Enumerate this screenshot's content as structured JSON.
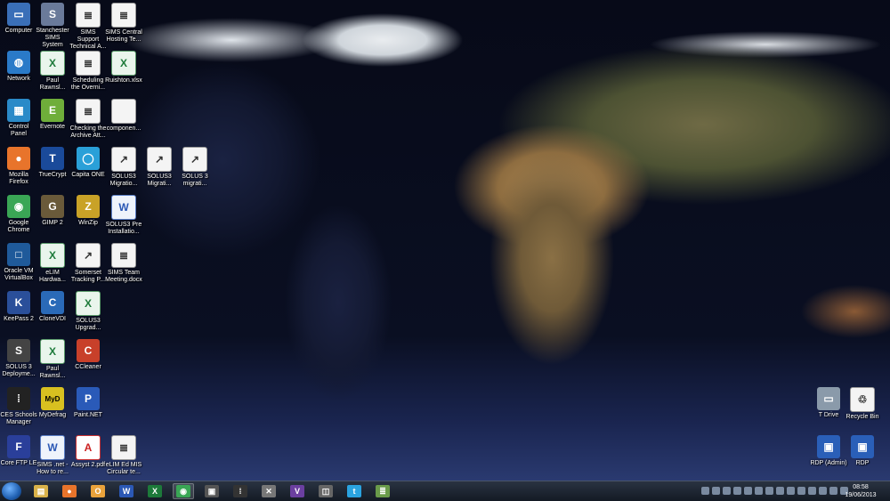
{
  "desktop_icons": [
    {
      "label": "Computer",
      "icon": "computer-icon"
    },
    {
      "label": "Stanchester SIMS System",
      "icon": "sims-icon"
    },
    {
      "label": "SIMS Support Technical A...",
      "icon": "document-icon"
    },
    {
      "label": "SIMS Central Hosting Te...",
      "icon": "document-icon"
    },
    {
      "label": "Network",
      "icon": "network-icon"
    },
    {
      "label": "Paul Rawnsl...",
      "icon": "excel-icon"
    },
    {
      "label": "Scheduling the Overni...",
      "icon": "document-icon"
    },
    {
      "label": "Ruishton.xlsx",
      "icon": "excel-icon"
    },
    {
      "label": "Control Panel",
      "icon": "control-panel-icon"
    },
    {
      "label": "Evernote",
      "icon": "evernote-icon"
    },
    {
      "label": "Checking the Archive Att...",
      "icon": "document-icon"
    },
    {
      "label": "componen...",
      "icon": "file-icon"
    },
    {
      "label": "Mozilla Firefox",
      "icon": "firefox-icon"
    },
    {
      "label": "TrueCrypt",
      "icon": "truecrypt-icon"
    },
    {
      "label": "Capita ONE",
      "icon": "capita-icon"
    },
    {
      "label": "SOLUS3 Migratio...",
      "icon": "shortcut-icon"
    },
    {
      "label": "SOLUS3 Migrati...",
      "icon": "shortcut-icon"
    },
    {
      "label": "SOLUS 3 migrati...",
      "icon": "shortcut-icon"
    },
    {
      "label": "Google Chrome",
      "icon": "chrome-icon"
    },
    {
      "label": "GIMP 2",
      "icon": "gimp-icon"
    },
    {
      "label": "WinZip",
      "icon": "winzip-icon"
    },
    {
      "label": "SOLUS3 Pre Installatio...",
      "icon": "word-icon"
    },
    {
      "label": "Oracle VM VirtualBox",
      "icon": "virtualbox-icon"
    },
    {
      "label": "eLIM Hardwa...",
      "icon": "excel-icon"
    },
    {
      "label": "Somerset Tracking P...",
      "icon": "shortcut-icon"
    },
    {
      "label": "SIMS Team Meeting.docx",
      "icon": "document-icon"
    },
    {
      "label": "KeePass 2",
      "icon": "keepass-icon"
    },
    {
      "label": "CloneVDI",
      "icon": "clonevdi-icon"
    },
    {
      "label": "SOLUS3 Upgrad...",
      "icon": "excel-icon"
    },
    {
      "label": "SOLUS 3 Deployme...",
      "icon": "solus-icon"
    },
    {
      "label": "Paul Rawnsl...",
      "icon": "excel-icon"
    },
    {
      "label": "CCleaner",
      "icon": "ccleaner-icon"
    },
    {
      "label": "CES Schools Manager",
      "icon": "traffic-light-icon"
    },
    {
      "label": "MyDefrag",
      "icon": "mydefrag-icon"
    },
    {
      "label": "Paint.NET",
      "icon": "paintnet-icon"
    },
    {
      "label": "Core FTP LE",
      "icon": "coreftp-icon"
    },
    {
      "label": "SIMS .net - How to re...",
      "icon": "word-icon"
    },
    {
      "label": "Assyst 2.pdf",
      "icon": "pdf-icon"
    },
    {
      "label": "eLIM Ed MIS Circular te...",
      "icon": "document-icon"
    },
    {
      "label": "T Drive",
      "icon": "drive-icon"
    },
    {
      "label": "Recycle Bin",
      "icon": "recycle-bin-icon"
    },
    {
      "label": "RDP (Admin)",
      "icon": "rdp-icon"
    },
    {
      "label": "RDP",
      "icon": "rdp-icon"
    }
  ],
  "taskbar": {
    "start_icon": "windows-start-icon",
    "pinned": [
      {
        "icon": "explorer-icon",
        "glyph": "▤",
        "color": "#d9b24a"
      },
      {
        "icon": "firefox-icon",
        "glyph": "●",
        "color": "#e8742b"
      },
      {
        "icon": "outlook-icon",
        "glyph": "O",
        "color": "#e9a23b"
      },
      {
        "icon": "word-icon",
        "glyph": "W",
        "color": "#2b58b5"
      },
      {
        "icon": "excel-icon",
        "glyph": "X",
        "color": "#1d7a3a"
      },
      {
        "icon": "chrome-icon",
        "glyph": "◉",
        "color": "#3aa655"
      },
      {
        "icon": "media-icon",
        "glyph": "▣",
        "color": "#555"
      },
      {
        "icon": "traffic-light-icon",
        "glyph": "⁞",
        "color": "#333"
      },
      {
        "icon": "tools-icon",
        "glyph": "✕",
        "color": "#777"
      },
      {
        "icon": "visual-studio-icon",
        "glyph": "V",
        "color": "#6b3fa0"
      },
      {
        "icon": "screenshot-icon",
        "glyph": "◫",
        "color": "#666"
      },
      {
        "icon": "twitter-icon",
        "glyph": "t",
        "color": "#2aa3e0"
      },
      {
        "icon": "document-icon",
        "glyph": "≣",
        "color": "#6a9b4a"
      }
    ],
    "clock_time": "08:58",
    "clock_date": "19/06/2013"
  }
}
